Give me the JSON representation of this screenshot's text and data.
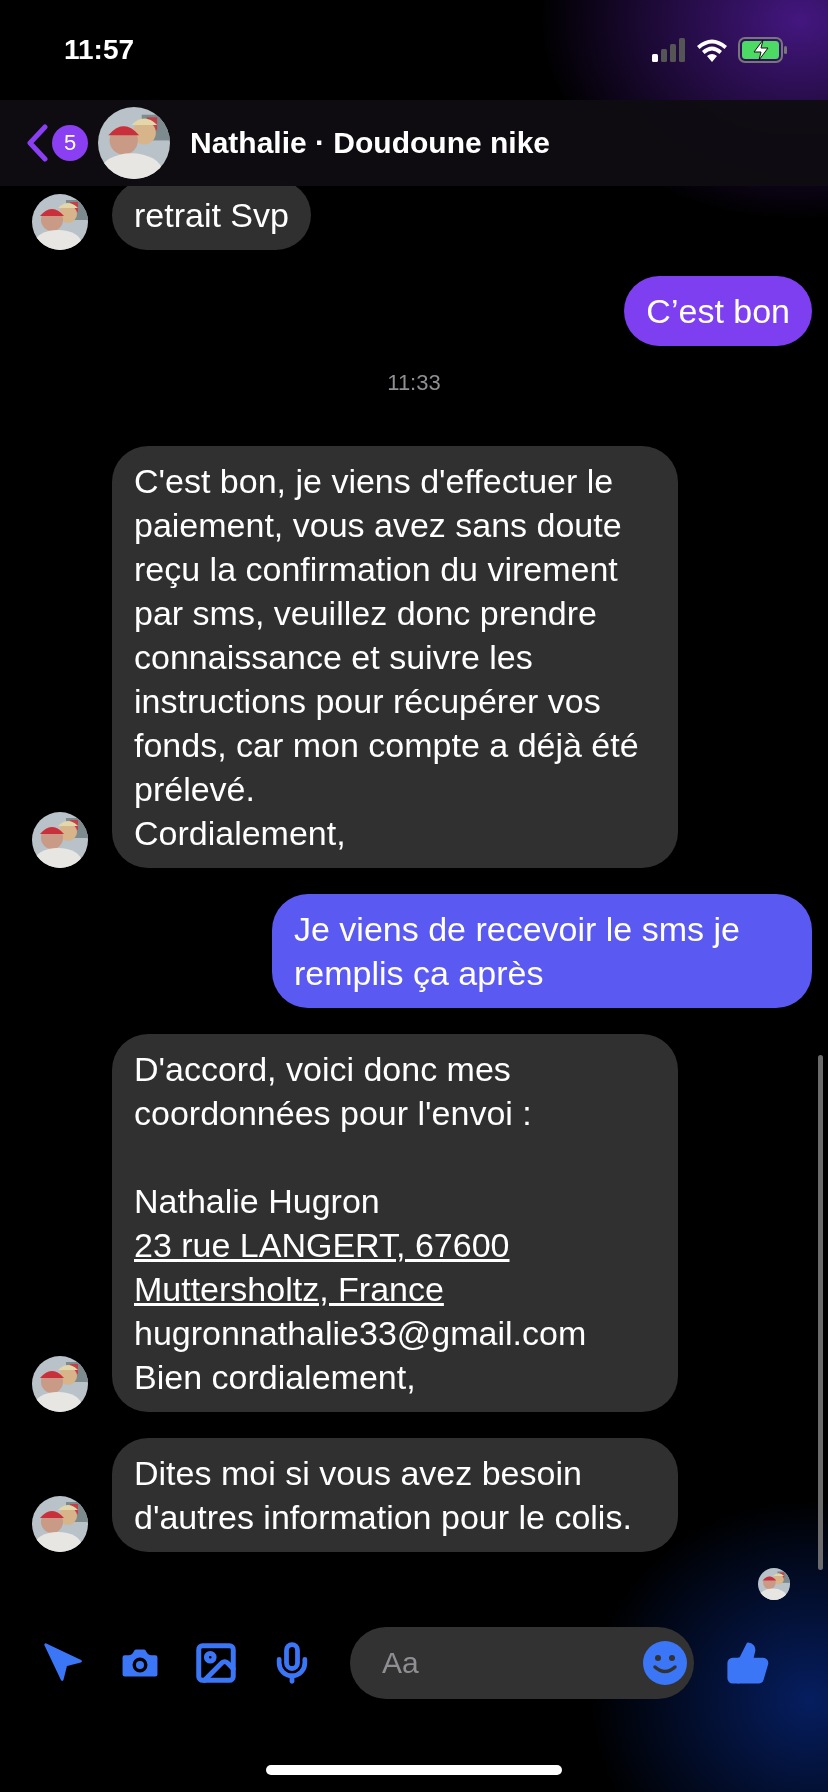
{
  "status_bar": {
    "time": "11:57"
  },
  "header": {
    "back_badge": "5",
    "title": "Nathalie · Doudoune nike"
  },
  "messages": [
    {
      "kind": "received",
      "avatar": true,
      "paragraphs": [
        {
          "text": "retrait Svp",
          "link": false,
          "gap_before": false
        }
      ]
    },
    {
      "kind": "sent",
      "color": "#7d3ff0",
      "paragraphs": [
        {
          "text": "C’est bon",
          "link": false,
          "gap_before": false
        }
      ]
    },
    {
      "kind": "timestamp",
      "text": "11:33"
    },
    {
      "kind": "received",
      "avatar": true,
      "paragraphs": [
        {
          "text": "C'est bon, je viens d'effectuer le paiement, vous avez sans doute reçu la confirmation du virement par sms, veuillez donc prendre connaissance et suivre les instructions pour récupérer vos fonds, car mon compte a déjà été prélevé.",
          "link": false,
          "gap_before": false
        },
        {
          "text": "Cordialement,",
          "link": false,
          "gap_before": false
        }
      ]
    },
    {
      "kind": "sent",
      "color": "#5a5af2",
      "paragraphs": [
        {
          "text": "Je viens de recevoir le sms je remplis ça après",
          "link": false,
          "gap_before": false
        }
      ]
    },
    {
      "kind": "received",
      "avatar": true,
      "paragraphs": [
        {
          "text": "D'accord, voici donc mes coordonnées pour l'envoi :",
          "link": false,
          "gap_before": false
        },
        {
          "text": "Nathalie Hugron",
          "link": false,
          "gap_before": true
        },
        {
          "text": "23 rue LANGERT, 67600",
          "link": true,
          "gap_before": false
        },
        {
          "text": "Muttersholtz, France",
          "link": true,
          "gap_before": false
        },
        {
          "text": "hugronnathalie33@gmail.com",
          "link": false,
          "gap_before": false
        },
        {
          "text": "Bien cordialement,",
          "link": false,
          "gap_before": false
        }
      ]
    },
    {
      "kind": "received",
      "avatar": true,
      "paragraphs": [
        {
          "text": "Dites moi si vous avez besoin d'autres information pour le colis.",
          "link": false,
          "gap_before": false
        }
      ]
    }
  ],
  "composer": {
    "placeholder": "Aa"
  }
}
